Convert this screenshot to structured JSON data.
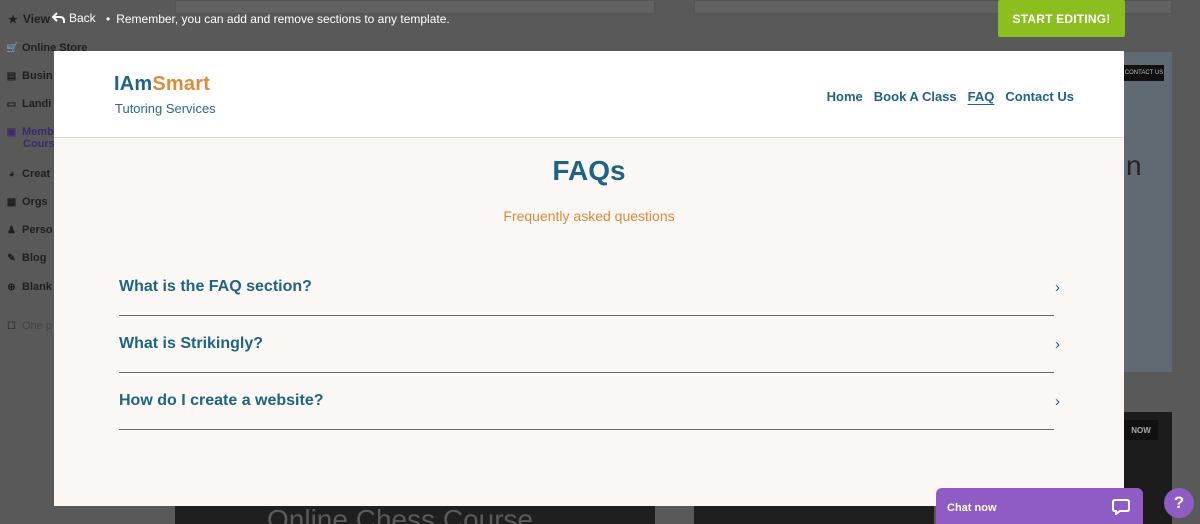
{
  "editor_bar": {
    "view_label": "View",
    "back_label": "Back",
    "separator": "•",
    "message": "Remember, you can add and remove sections to any template.",
    "start_button": "START EDITING!"
  },
  "sidebar": {
    "items": [
      {
        "label": "Online Store",
        "icon": "cart-icon"
      },
      {
        "label": "Busin",
        "icon": "clipboard-icon"
      },
      {
        "label": "Landi",
        "icon": "window-icon"
      },
      {
        "label": "Memb",
        "sub": "Cours",
        "icon": "id-card-icon"
      },
      {
        "label": "Creat",
        "icon": "palette-icon"
      },
      {
        "label": "Orgs",
        "icon": "briefcase-icon"
      },
      {
        "label": "Perso",
        "icon": "person-icon"
      },
      {
        "label": "Blog",
        "icon": "pen-icon"
      },
      {
        "label": "Blank",
        "icon": "plus-circle-icon"
      },
      {
        "label": "One p",
        "icon": "checkbox-icon"
      }
    ]
  },
  "background": {
    "contact_btn": "CONTACT US",
    "right_letter": "n",
    "now_btn": "NOW",
    "bottom_title": "Online Chess Course"
  },
  "site": {
    "logo_part1": "IAm",
    "logo_part2": "Smart",
    "tagline": "Tutoring Services",
    "nav": [
      {
        "label": "Home",
        "active": false
      },
      {
        "label": "Book A Class",
        "active": false
      },
      {
        "label": "FAQ",
        "active": true
      },
      {
        "label": "Contact Us",
        "active": false
      }
    ],
    "faq_title": "FAQs",
    "faq_subtitle": "Frequently asked questions",
    "faqs": [
      {
        "question": "What is the FAQ section?"
      },
      {
        "question": "What is Strikingly?"
      },
      {
        "question": "How do I create a website?"
      }
    ],
    "colors": {
      "primary": "#1f6385",
      "accent": "#e08a3c",
      "background": "#fbf7f4"
    }
  },
  "chat": {
    "label": "Chat now",
    "help": "?"
  },
  "colors": {
    "start_button": "#8bbe1f",
    "chat": "#8e5cc4",
    "overlay": "#595959"
  }
}
